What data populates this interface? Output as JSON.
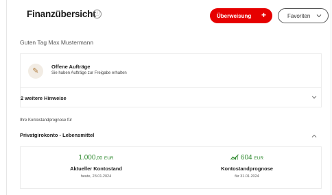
{
  "header": {
    "title": "Finanzübersicht",
    "info_icon": "ⓘ",
    "transfer_button": "Überweisung",
    "transfer_plus": "+",
    "favorites_button": "Favoriten"
  },
  "greeting": "Guten Tag Max Mustermann",
  "tasks": {
    "title": "Offene Aufträge",
    "subtitle": "Sie haben Aufträge zur Freigabe erhalten",
    "icon": "edit-icon"
  },
  "hints": "2 weitere Hinweise",
  "forecast": {
    "label": "Ihre Kontostandprognose für",
    "account": "Privatgirokonto - Lebensmittel",
    "current": {
      "amount_int": "1.000",
      "amount_dec": ",00",
      "currency": "EUR",
      "label": "Aktueller Kontostand",
      "date": "heute, 23.01.2024"
    },
    "forecast": {
      "amount_int": "604",
      "currency": "EUR",
      "label": "Kontostandprognose",
      "date": "für 31.01.2024"
    }
  },
  "colors": {
    "accent_red": "#e60000",
    "positive_green": "#2f8a2f"
  }
}
